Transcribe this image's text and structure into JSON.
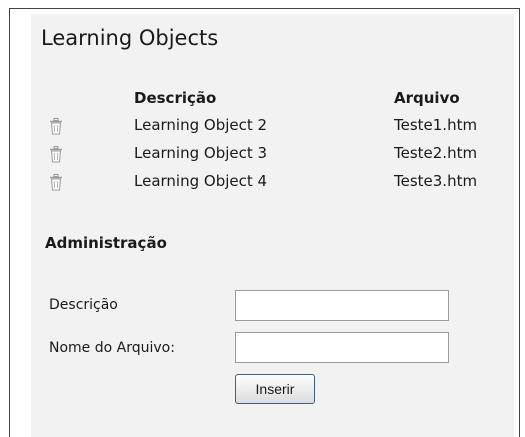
{
  "panel": {
    "title": "Learning Objects"
  },
  "table": {
    "headers": {
      "descricao": "Descrição",
      "arquivo": "Arquivo"
    },
    "rows": [
      {
        "descricao": "Learning Object 2",
        "arquivo": "Teste1.htm",
        "icon": "trash-icon"
      },
      {
        "descricao": "Learning Object 3",
        "arquivo": "Teste2.htm",
        "icon": "trash-icon"
      },
      {
        "descricao": "Learning Object 4",
        "arquivo": "Teste3.htm",
        "icon": "trash-icon"
      }
    ]
  },
  "admin": {
    "section_title": "Administração",
    "fields": {
      "descricao_label": "Descrição",
      "descricao_value": "",
      "arquivo_label": "Nome do Arquivo:",
      "arquivo_value": ""
    },
    "submit_label": "Inserir"
  }
}
